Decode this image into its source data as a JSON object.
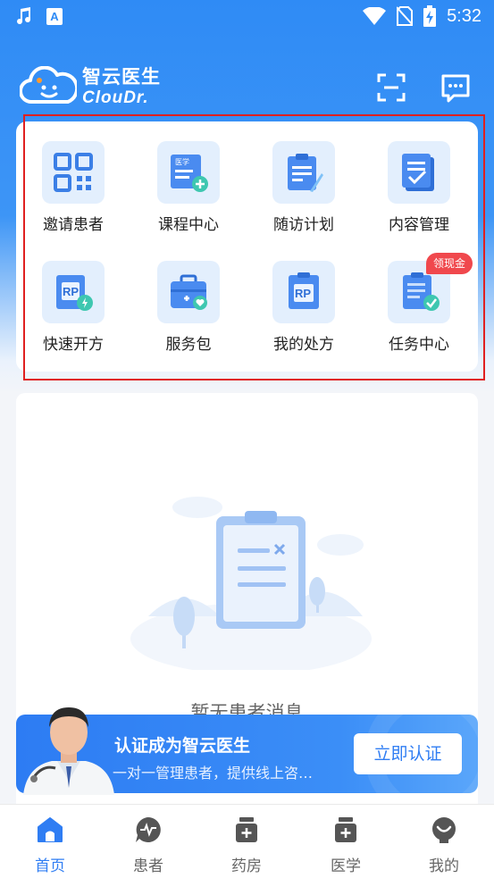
{
  "status_bar": {
    "time": "5:32",
    "a_label": "A"
  },
  "header": {
    "logo_cn": "智云医生",
    "logo_en": "ClouDr."
  },
  "quick_actions": [
    {
      "label": "邀请患者",
      "icon": "qr-code-icon"
    },
    {
      "label": "课程中心",
      "icon": "course-icon",
      "icon_text": "医学"
    },
    {
      "label": "随访计划",
      "icon": "clipboard-pen-icon"
    },
    {
      "label": "内容管理",
      "icon": "document-check-icon"
    },
    {
      "label": "快速开方",
      "icon": "rx-fast-icon"
    },
    {
      "label": "服务包",
      "icon": "medical-kit-icon"
    },
    {
      "label": "我的处方",
      "icon": "rx-icon"
    },
    {
      "label": "任务中心",
      "icon": "task-list-icon"
    }
  ],
  "badge": {
    "text": "领现金"
  },
  "empty_state": {
    "text": "暂无患者消息"
  },
  "certify": {
    "title": "认证成为智云医生",
    "subtitle": "一对一管理患者，提供线上咨…",
    "button": "立即认证"
  },
  "tabs": [
    {
      "label": "首页",
      "active": true
    },
    {
      "label": "患者",
      "active": false
    },
    {
      "label": "药房",
      "active": false
    },
    {
      "label": "医学",
      "active": false
    },
    {
      "label": "我的",
      "active": false
    }
  ],
  "colors": {
    "primary": "#2f7df3",
    "icon_bg": "#e3effd",
    "badge": "#f0484d",
    "highlight": "#e02020"
  }
}
